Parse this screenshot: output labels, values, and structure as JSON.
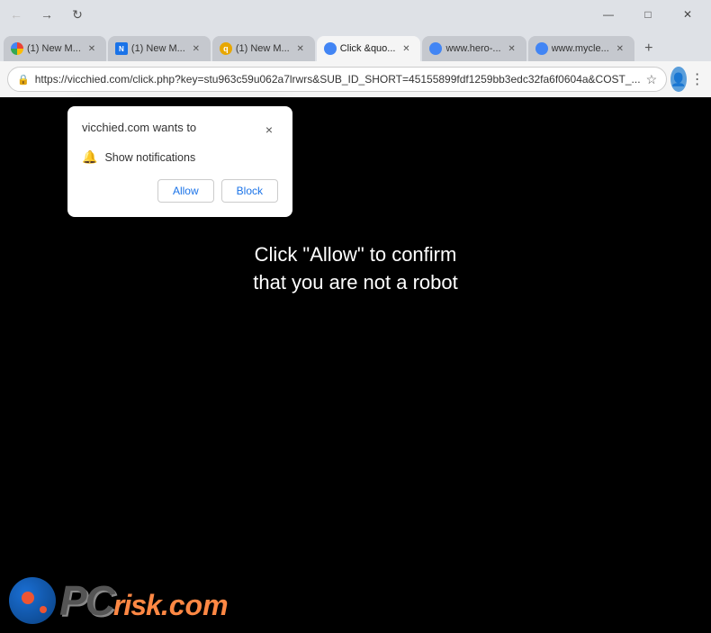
{
  "browser": {
    "tabs": [
      {
        "id": "tab1",
        "favicon_type": "chrome",
        "title": "(1) New M...",
        "active": false
      },
      {
        "id": "tab2",
        "favicon_type": "square",
        "title": "(1) New M...",
        "active": false
      },
      {
        "id": "tab3",
        "favicon_type": "q",
        "title": "(1) New M...",
        "active": false
      },
      {
        "id": "tab4",
        "favicon_type": "globe",
        "title": "Click &quo...",
        "active": true
      },
      {
        "id": "tab5",
        "favicon_type": "globe",
        "title": "www.hero-...",
        "active": false
      },
      {
        "id": "tab6",
        "favicon_type": "globe",
        "title": "www.mycle...",
        "active": false
      }
    ],
    "address_bar": {
      "url": "https://vicchied.com/click.php?key=stu963c59u062a7lrwrs&SUB_ID_SHORT=45155899fdf1259bb3edc32fa6f0604a&COST_...",
      "lock_icon": "🔒"
    },
    "window_controls": {
      "minimize": "—",
      "maximize": "□",
      "close": "✕"
    }
  },
  "notification_popup": {
    "site": "vicchied.com",
    "wants_to_text": " wants to",
    "title": "vicchied.com wants to",
    "close_label": "×",
    "notification_text": "Show notifications",
    "allow_label": "Allow",
    "block_label": "Block"
  },
  "page": {
    "main_text_line1": "Click \"Allow\" to confirm",
    "main_text_line2": "that you are not a robot",
    "bg_color": "#000000"
  },
  "logo": {
    "pc_text": "PC",
    "risk_text": "risk",
    "dot_text": ".",
    "com_text": "com"
  }
}
